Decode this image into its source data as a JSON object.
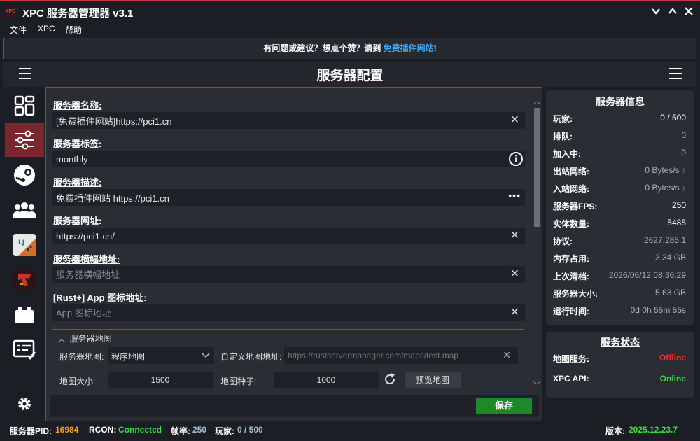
{
  "window": {
    "logo_text": "XPC",
    "title": "XPC 服务器管理器 v3.1",
    "controls": [
      "chevron-down",
      "chevron-up",
      "close"
    ]
  },
  "menu": [
    "文件",
    "XPC",
    "帮助"
  ],
  "banner": {
    "prefix": "有问题或建议？想点个赞？请到 ",
    "link": "免费插件网站",
    "suffix": "!"
  },
  "header": {
    "title": "服务器配置"
  },
  "sidebar": {
    "items": [
      "dashboard-icon",
      "sliders-icon",
      "steam-icon",
      "users-icon",
      "plugin-icon",
      "rust-icon",
      "battery-icon",
      "console-icon",
      "settings-icon"
    ],
    "active": "sliders-icon"
  },
  "form": {
    "fields": [
      {
        "label": "服务器名称:",
        "value": "[免费插件网站]https://pci1.cn",
        "placeholder": "",
        "action": "clear"
      },
      {
        "label": "服务器标签:",
        "value": "monthly",
        "placeholder": "",
        "action": "info"
      },
      {
        "label": "服务器描述:",
        "value": "免费插件网站 https://pci1.cn",
        "placeholder": "",
        "action": "more"
      },
      {
        "label": "服务器网址:",
        "value": "https://pci1.cn/",
        "placeholder": "",
        "action": "clear"
      },
      {
        "label": "服务器横幅地址:",
        "value": "",
        "placeholder": "服务器横幅地址",
        "action": "clear"
      },
      {
        "label": "[Rust+] App 图标地址:",
        "value": "",
        "placeholder": "App 图标地址",
        "action": "clear"
      }
    ],
    "map": {
      "header": "服务器地图",
      "map_label": "服务器地图:",
      "map_value": "程序地图",
      "custom_label": "自定义地图地址:",
      "custom_placeholder": "https://rustservermanager.com/maps/test.map",
      "size_label": "地图大小:",
      "size_value": "1500",
      "seed_label": "地图种子:",
      "seed_value": "1000",
      "preview_button": "预览地图"
    },
    "save_label": "保存"
  },
  "server_info": {
    "title": "服务器信息",
    "rows": [
      {
        "label": "玩家:",
        "value": "0 / 500",
        "bright": true
      },
      {
        "label": "排队:",
        "value": "0",
        "bright": false
      },
      {
        "label": "加入中:",
        "value": "0",
        "bright": false
      },
      {
        "label": "出站网络:",
        "value": "0 Bytes/s ↑",
        "bright": false
      },
      {
        "label": "入站网络:",
        "value": "0 Bytes/s ↓",
        "bright": false
      },
      {
        "label": "服务器FPS:",
        "value": "250",
        "bright": true
      },
      {
        "label": "实体数量:",
        "value": "5485",
        "bright": true
      },
      {
        "label": "协议:",
        "value": "2627.285.1",
        "bright": false
      },
      {
        "label": "内存占用:",
        "value": "3.34 GB",
        "bright": false
      },
      {
        "label": "上次清档:",
        "value": "2026/06/12 08:36:29",
        "bright": false
      },
      {
        "label": "服务器大小:",
        "value": "5.63 GB",
        "bright": false
      },
      {
        "label": "运行时间:",
        "value": "0d 0h 55m 55s",
        "bright": false
      }
    ]
  },
  "service_status": {
    "title": "服务状态",
    "rows": [
      {
        "label": "地图服务:",
        "value": "Offline",
        "status": "red"
      },
      {
        "label": "XPC API:",
        "value": "Online",
        "status": "green"
      }
    ]
  },
  "statusbar": {
    "pid_label": "服务器PID:",
    "pid_value": "16984",
    "rcon_label": "RCON:",
    "rcon_value": "Connected",
    "fps_label": "帧率:",
    "fps_value": "250",
    "players_label": "玩家:",
    "players_value": "0 / 500",
    "version_label": "版本:",
    "version_value": "2025.12.23.7"
  },
  "colors": {
    "accent_red": "#b3353c",
    "save_green": "#1b8a2a",
    "online_green": "#2fe03f",
    "offline_red": "#ff2a2a",
    "pid_orange": "#f0a020",
    "link_blue": "#3ba7f2"
  }
}
